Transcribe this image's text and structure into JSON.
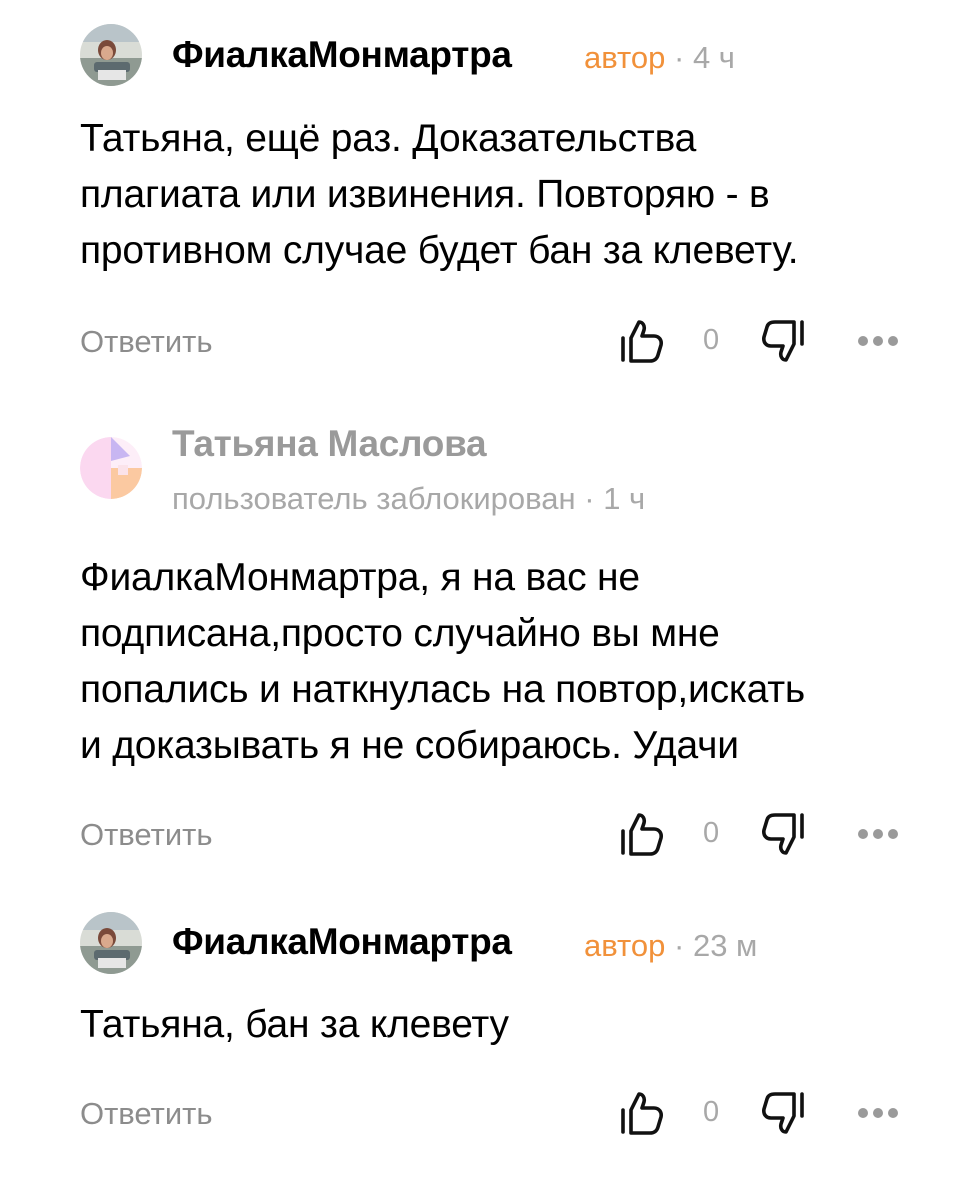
{
  "comments": [
    {
      "author": "ФиалкаМонмартра",
      "badge": "автор",
      "separator": "·",
      "time": "4 ч",
      "lines": [
        "Татьяна, ещё раз. Доказательства",
        "плагиата или извинения. Повторяю - в",
        "противном случае будет бан за клевету."
      ],
      "reply_label": "Ответить",
      "score": "0"
    },
    {
      "author": "Татьяна Маслова",
      "status": "пользователь заблокирован",
      "separator": "·",
      "time": "1 ч",
      "lines": [
        "ФиалкаМонмартра, я на вас не",
        "подписана,просто случайно вы мне",
        "попались и наткнулась на повтор,искать",
        "и доказывать я не собираюсь. Удачи"
      ],
      "reply_label": "Ответить",
      "score": "0"
    },
    {
      "author": "ФиалкаМонмартра",
      "badge": "автор",
      "separator": "·",
      "time": "23 м",
      "lines": [
        "Татьяна, бан за клевету"
      ],
      "reply_label": "Ответить",
      "score": "0"
    }
  ],
  "icons": {
    "like": "thumbs-up-icon",
    "dislike": "thumbs-down-icon",
    "more": "more-dots-icon"
  },
  "colors": {
    "author_badge": "#f1913a",
    "muted": "#a8a8a8",
    "reply": "#8c8c8c",
    "icon_stroke": "#111111"
  }
}
